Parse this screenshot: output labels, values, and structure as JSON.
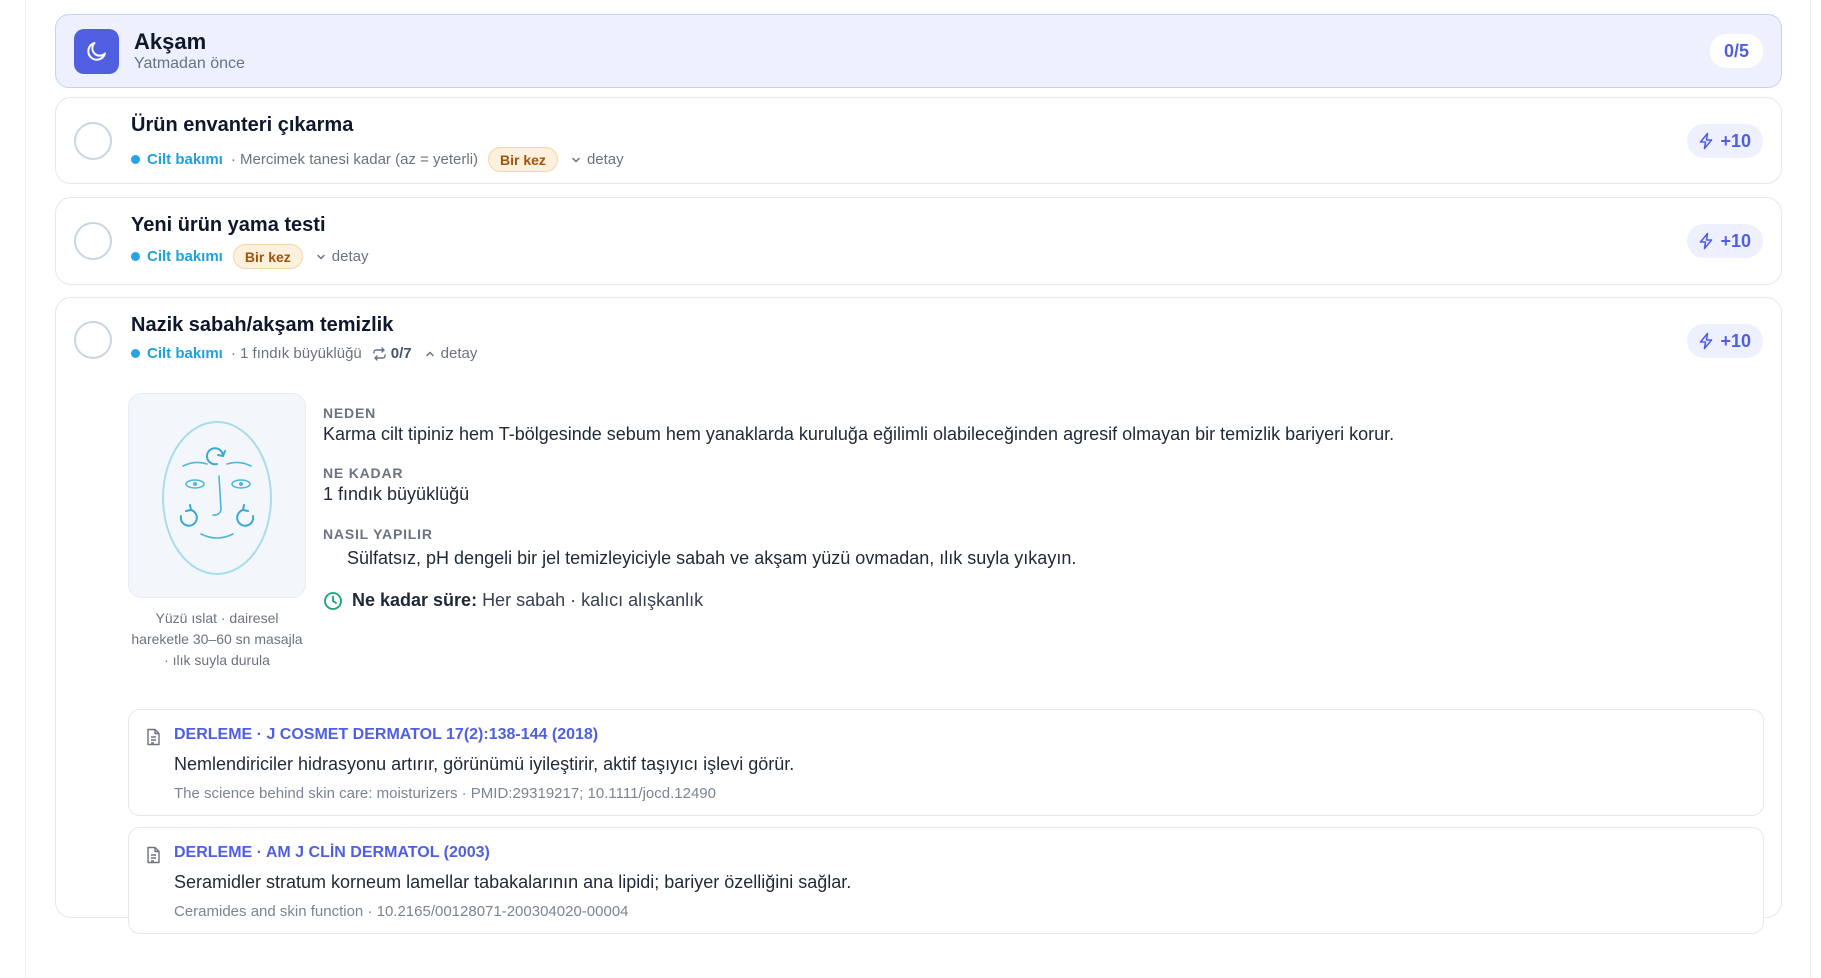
{
  "section": {
    "title": "Akşam",
    "subtitle": "Yatmadan önce",
    "progress": "0/5",
    "icon": "moon-icon",
    "accent_color": "#4f5fe0"
  },
  "tasks": [
    {
      "title": "Ürün envanteri çıkarma",
      "category": "Cilt bakımı",
      "amount": "· Mercimek tanesi kadar (az = yeterli)",
      "badge": "Bir kez",
      "detail_label": "detay",
      "xp": "+10"
    },
    {
      "title": "Yeni ürün yama testi",
      "category": "Cilt bakımı",
      "badge": "Bir kez",
      "detail_label": "detay",
      "xp": "+10"
    },
    {
      "title": "Nazik sabah/akşam temizlik",
      "category": "Cilt bakımı",
      "amount": "· 1 fındık büyüklüğü",
      "repeat": "0/7",
      "detail_label": "detay",
      "xp": "+10",
      "expanded": true,
      "illustration_caption": "Yüzü ıslat · dairesel hareketle 30–60 sn masajla · ılık suyla durula",
      "why_label": "NEDEN",
      "why_text": "Karma cilt tipiniz hem T-bölgesinde sebum hem yanaklarda kuruluğa eğilimli olabileceğinden agresif olmayan bir temizlik bariyeri korur.",
      "amount_label": "NE KADAR",
      "amount_text": "1 fındık büyüklüğü",
      "how_label": "NASIL YAPILIR",
      "how_text": "Sülfatsız, pH dengeli bir jel temizleyiciyle sabah ve akşam yüzü ovmadan, ılık suyla yıkayın.",
      "duration_label": "Ne kadar süre:",
      "duration_text": "Her sabah · kalıcı alışkanlık",
      "references": [
        {
          "title": "DERLEME · J COSMET DERMATOL 17(2):138-144 (2018)",
          "text": "Nemlendiriciler hidrasyonu artırır, görünümü iyileştirir, aktif taşıyıcı işlevi görür.",
          "source": "The science behind skin care: moisturizers · PMID:29319217; 10.1111/jocd.12490"
        },
        {
          "title": "DERLEME · AM J CLİN DERMATOL (2003)",
          "text": "Seramidler stratum korneum lamellar tabakalarının ana lipidi; bariyer özelliğini sağlar.",
          "source": "Ceramides and skin function · 10.2165/00128071-200304020-00004"
        }
      ]
    }
  ],
  "colors": {
    "category": "#1ea2dc",
    "badge_bg": "#fdf0dd",
    "badge_text": "#a0530d",
    "timer": "#16a37a"
  }
}
